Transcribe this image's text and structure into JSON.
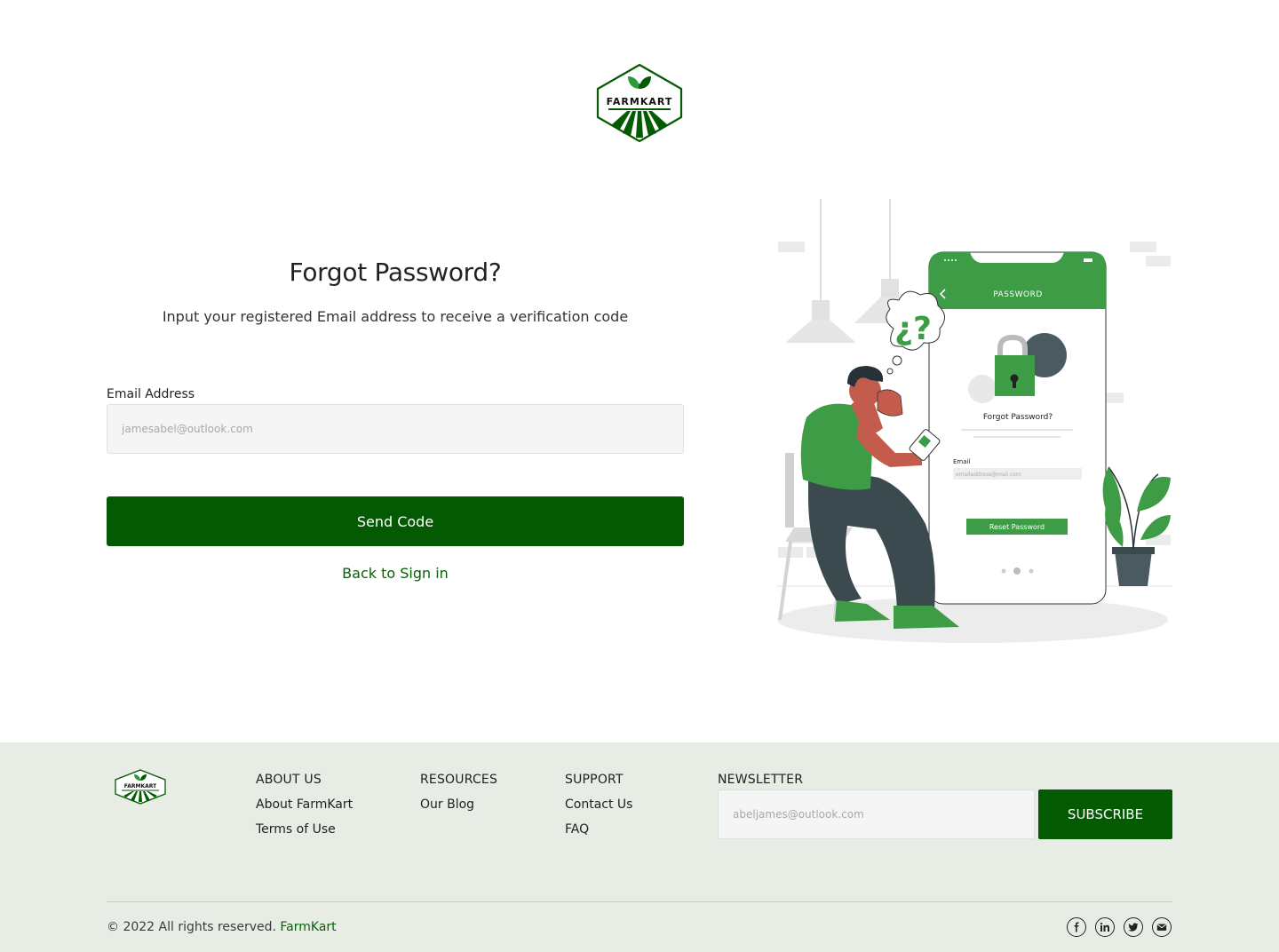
{
  "brand": {
    "name": "FarmKart",
    "logo_text": "FARMKART",
    "primary_color": "#035a03",
    "accent_color": "#3d9c45"
  },
  "form": {
    "title": "Forgot Password?",
    "subtitle": "Input your registered Email address to receive a verification code",
    "email_label": "Email Address",
    "email_placeholder": "jamesabel@outlook.com",
    "submit_label": "Send Code",
    "back_link": "Back to Sign in"
  },
  "illustration": {
    "phone_header": "PASSWORD",
    "phone_title": "Forgot Password?",
    "phone_email_label": "Email",
    "phone_email_placeholder": "emailaddress@mail.com",
    "phone_button": "Reset Password",
    "bubble_text": "¿?"
  },
  "footer": {
    "columns": [
      {
        "heading": "ABOUT US",
        "links": [
          "About FarmKart",
          "Terms of Use"
        ]
      },
      {
        "heading": "RESOURCES",
        "links": [
          "Our Blog"
        ]
      },
      {
        "heading": "SUPPORT",
        "links": [
          "Contact Us",
          "FAQ"
        ]
      }
    ],
    "newsletter": {
      "heading": "NEWSLETTER",
      "placeholder": "abeljames@outlook.com",
      "button": "SUBSCRIBE"
    },
    "copyright": "© 2022 All rights reserved.",
    "copyright_brand": "FarmKart",
    "social_icons": [
      "facebook-icon",
      "linkedin-icon",
      "twitter-icon",
      "email-icon"
    ]
  }
}
